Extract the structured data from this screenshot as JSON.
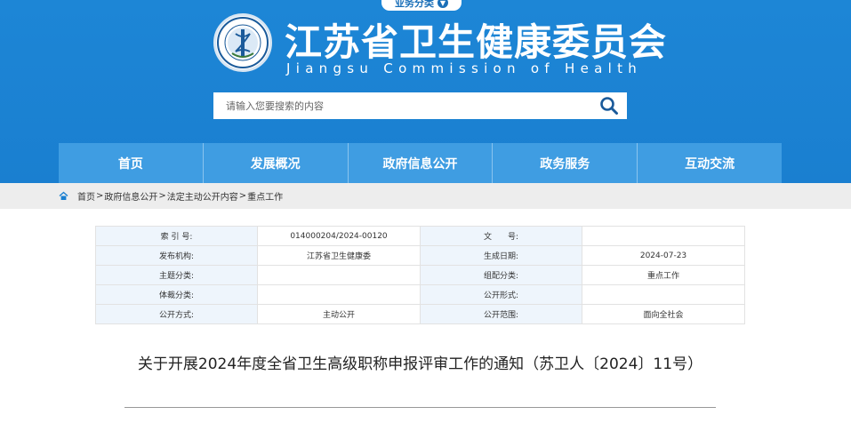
{
  "header": {
    "business_tab": "业务分类",
    "title_cn": "江苏省卫生健康委员会",
    "title_en": "Jiangsu Commission of Health",
    "search_placeholder": "请输入您要搜索的内容"
  },
  "nav": {
    "items": [
      "首页",
      "发展概况",
      "政府信息公开",
      "政务服务",
      "互动交流"
    ]
  },
  "breadcrumb": {
    "items": [
      "首页",
      "政府信息公开",
      "法定主动公开内容",
      "重点工作"
    ],
    "separator": ">"
  },
  "meta": {
    "index_label": "索 引 号:",
    "index_value": "014000204/2024-00120",
    "docno_label": "文　　号:",
    "docno_value": "",
    "publisher_label": "发布机构:",
    "publisher_value": "江苏省卫生健康委",
    "date_label": "生成日期:",
    "date_value": "2024-07-23",
    "topic_label": "主题分类:",
    "topic_value": "",
    "group_label": "组配分类:",
    "group_value": "重点工作",
    "genre_label": "体裁分类:",
    "genre_value": "",
    "form_label": "公开形式:",
    "form_value": "",
    "mode_label": "公开方式:",
    "mode_value": "主动公开",
    "scope_label": "公开范围:",
    "scope_value": "面向全社会"
  },
  "document": {
    "title": "关于开展2024年度全省卫生高级职称申报评审工作的通知（苏卫人〔2024〕11号）"
  },
  "colors": {
    "header_blue": "#1a7fd0",
    "nav_blue": "#3f9de2",
    "crumb_bg": "#ededed",
    "label_bg": "#eef5fc"
  }
}
